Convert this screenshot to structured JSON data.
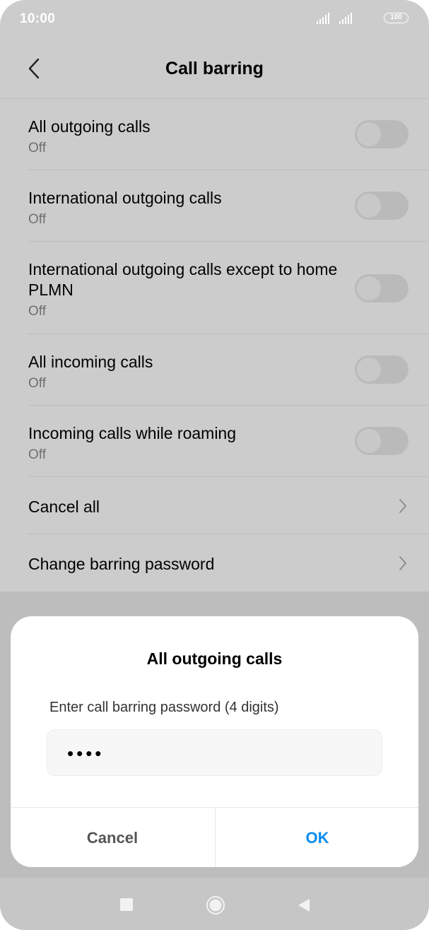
{
  "status_bar": {
    "time": "10:00",
    "battery": "100",
    "icons": [
      "signal-icon",
      "signal-icon",
      "battery-icon"
    ]
  },
  "header": {
    "title": "Call barring",
    "back_icon": "back-arrow-icon"
  },
  "settings": [
    {
      "title": "All outgoing calls",
      "subtitle": "Off",
      "control": "toggle",
      "on": false
    },
    {
      "title": "International outgoing calls",
      "subtitle": "Off",
      "control": "toggle",
      "on": false
    },
    {
      "title": "International outgoing calls except to home PLMN",
      "subtitle": "Off",
      "control": "toggle",
      "on": false
    },
    {
      "title": "All incoming calls",
      "subtitle": "Off",
      "control": "toggle",
      "on": false
    },
    {
      "title": "Incoming calls while roaming",
      "subtitle": "Off",
      "control": "toggle",
      "on": false
    },
    {
      "title": "Cancel all",
      "control": "chevron"
    },
    {
      "title": "Change barring password",
      "control": "chevron"
    }
  ],
  "dialog": {
    "title": "All outgoing calls",
    "label": "Enter call barring password (4 digits)",
    "input_value": "••••",
    "cancel_label": "Cancel",
    "ok_label": "OK"
  },
  "nav_bar": {
    "icons": [
      "recents-square-icon",
      "home-circle-icon",
      "back-triangle-icon"
    ]
  },
  "colors": {
    "accent": "#0a8cf0",
    "background_dimmed": "#cccccc"
  }
}
